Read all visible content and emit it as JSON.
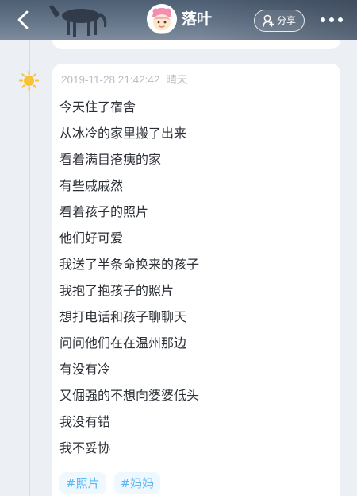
{
  "header": {
    "nickname": "落叶",
    "share_label": "分享",
    "icons": {
      "back": "back-arrow-icon",
      "share": "share-user-icon",
      "more": "more-dots-icon"
    }
  },
  "entry": {
    "datetime": "2019-11-28 21:42:42",
    "weather": "晴天",
    "weather_icon": "sun-icon",
    "lines": [
      "今天住了宿舍",
      "从冰冷的家里搬了出来",
      "看着满目疮痍的家",
      "有些戚戚然",
      "看着孩子的照片",
      "他们好可爱",
      "我送了半条命换来的孩子",
      "我抱了抱孩子的照片",
      "想打电话和孩子聊聊天",
      "问问他们在在温州那边",
      "有没有冷",
      "又倔强的不想向婆婆低头",
      "我没有错",
      "我不妥协"
    ],
    "tags": [
      "#照片",
      "#妈妈"
    ]
  },
  "colors": {
    "header_bg": "#5d6c80",
    "tag_text": "#5bb8f2",
    "meta_text": "#b9bec6",
    "sun": "#f7c234"
  }
}
